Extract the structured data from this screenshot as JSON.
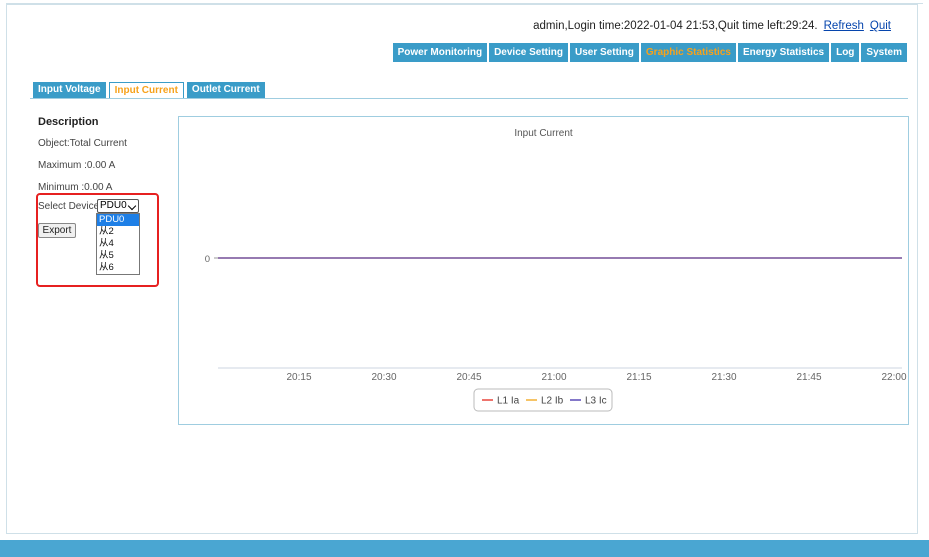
{
  "login": {
    "info": "admin,Login time:2022-01-04 21:53,Quit time left:29:24.",
    "refresh": "Refresh",
    "quit": "Quit"
  },
  "nav": {
    "items": [
      "Power Monitoring",
      "Device Setting",
      "User Setting",
      "Graphic Statistics",
      "Energy Statistics",
      "Log",
      "System"
    ],
    "active": "Graphic Statistics"
  },
  "tabs": {
    "items": [
      "Input Voltage",
      "Input Current",
      "Outlet Current"
    ],
    "active": "Input Current"
  },
  "description": {
    "title": "Description",
    "object": "Object:Total Current",
    "maximum": "Maximum :0.00 A",
    "minimum": "Minimum :0.00 A"
  },
  "device_select": {
    "label": "Select Device:",
    "selected": "PDU0",
    "options": [
      "PDU0",
      "从2",
      "从4",
      "从5",
      "从6"
    ]
  },
  "export_label": "Export",
  "colors": {
    "accent": "#3a9cc8",
    "active_text": "#f7a21b",
    "highlight_box": "#e62020",
    "series_l1": "#e8453c",
    "series_l2": "#f2b134",
    "series_l3": "#5b4bb7"
  },
  "chart_data": {
    "type": "line",
    "title": "Input Current",
    "x": [
      "20:15",
      "20:30",
      "20:45",
      "21:00",
      "21:15",
      "21:30",
      "21:45",
      "22:00"
    ],
    "y_tick": "0",
    "series": [
      {
        "name": "L1 Ia",
        "values": [
          0,
          0,
          0,
          0,
          0,
          0,
          0,
          0
        ]
      },
      {
        "name": "L2 Ib",
        "values": [
          0,
          0,
          0,
          0,
          0,
          0,
          0,
          0
        ]
      },
      {
        "name": "L3 Ic",
        "values": [
          0,
          0,
          0,
          0,
          0,
          0,
          0,
          0
        ]
      }
    ],
    "legend_position": "bottom-center"
  }
}
